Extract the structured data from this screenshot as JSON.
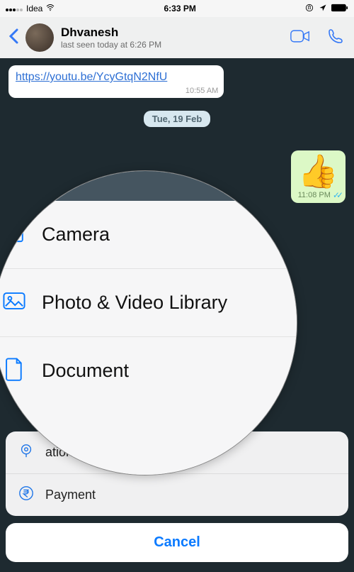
{
  "status_bar": {
    "carrier": "Idea",
    "time": "6:33 PM"
  },
  "header": {
    "name": "Dhvanesh",
    "last_seen": "last seen today at 6:26 PM"
  },
  "chat": {
    "link_text": "https://youtu.be/YcyGtqN2NfU",
    "link_time": "10:55 AM",
    "date_label": "Tue, 19 Feb",
    "thumbs_emoji": "👍",
    "thumbs_time": "11:08 PM"
  },
  "zoom": {
    "camera": "Camera",
    "photo": "Photo & Video Library",
    "document": "Document"
  },
  "sheet": {
    "location": "ation",
    "payment": "Payment",
    "cancel": "Cancel"
  }
}
